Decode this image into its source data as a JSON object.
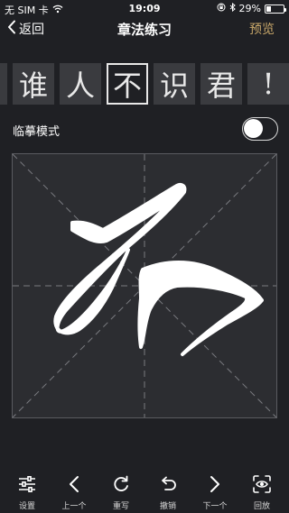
{
  "status_bar": {
    "carrier": "无 SIM 卡",
    "time": "19:09",
    "battery_percent": "29%",
    "battery_level": 0.29
  },
  "nav": {
    "back_label": "返回",
    "title": "章法练习",
    "preview_label": "预览"
  },
  "char_strip": {
    "items": [
      "谁",
      "人",
      "不",
      "识",
      "君",
      "!"
    ],
    "selected_index": 2
  },
  "tracing": {
    "label": "临摹模式",
    "enabled": false
  },
  "toolbar": {
    "items": [
      {
        "label": "设置",
        "icon": "sliders-icon"
      },
      {
        "label": "上一个",
        "icon": "chevron-left-icon"
      },
      {
        "label": "重写",
        "icon": "redo-icon"
      },
      {
        "label": "撤销",
        "icon": "undo-icon"
      },
      {
        "label": "下一个",
        "icon": "chevron-right-icon"
      },
      {
        "label": "回放",
        "icon": "replay-icon"
      }
    ]
  },
  "colors": {
    "background": "#1f2024",
    "accent": "#c9a86a",
    "cell": "#3a3b3f",
    "canvas": "#2c2d31",
    "ink": "#ffffff"
  }
}
